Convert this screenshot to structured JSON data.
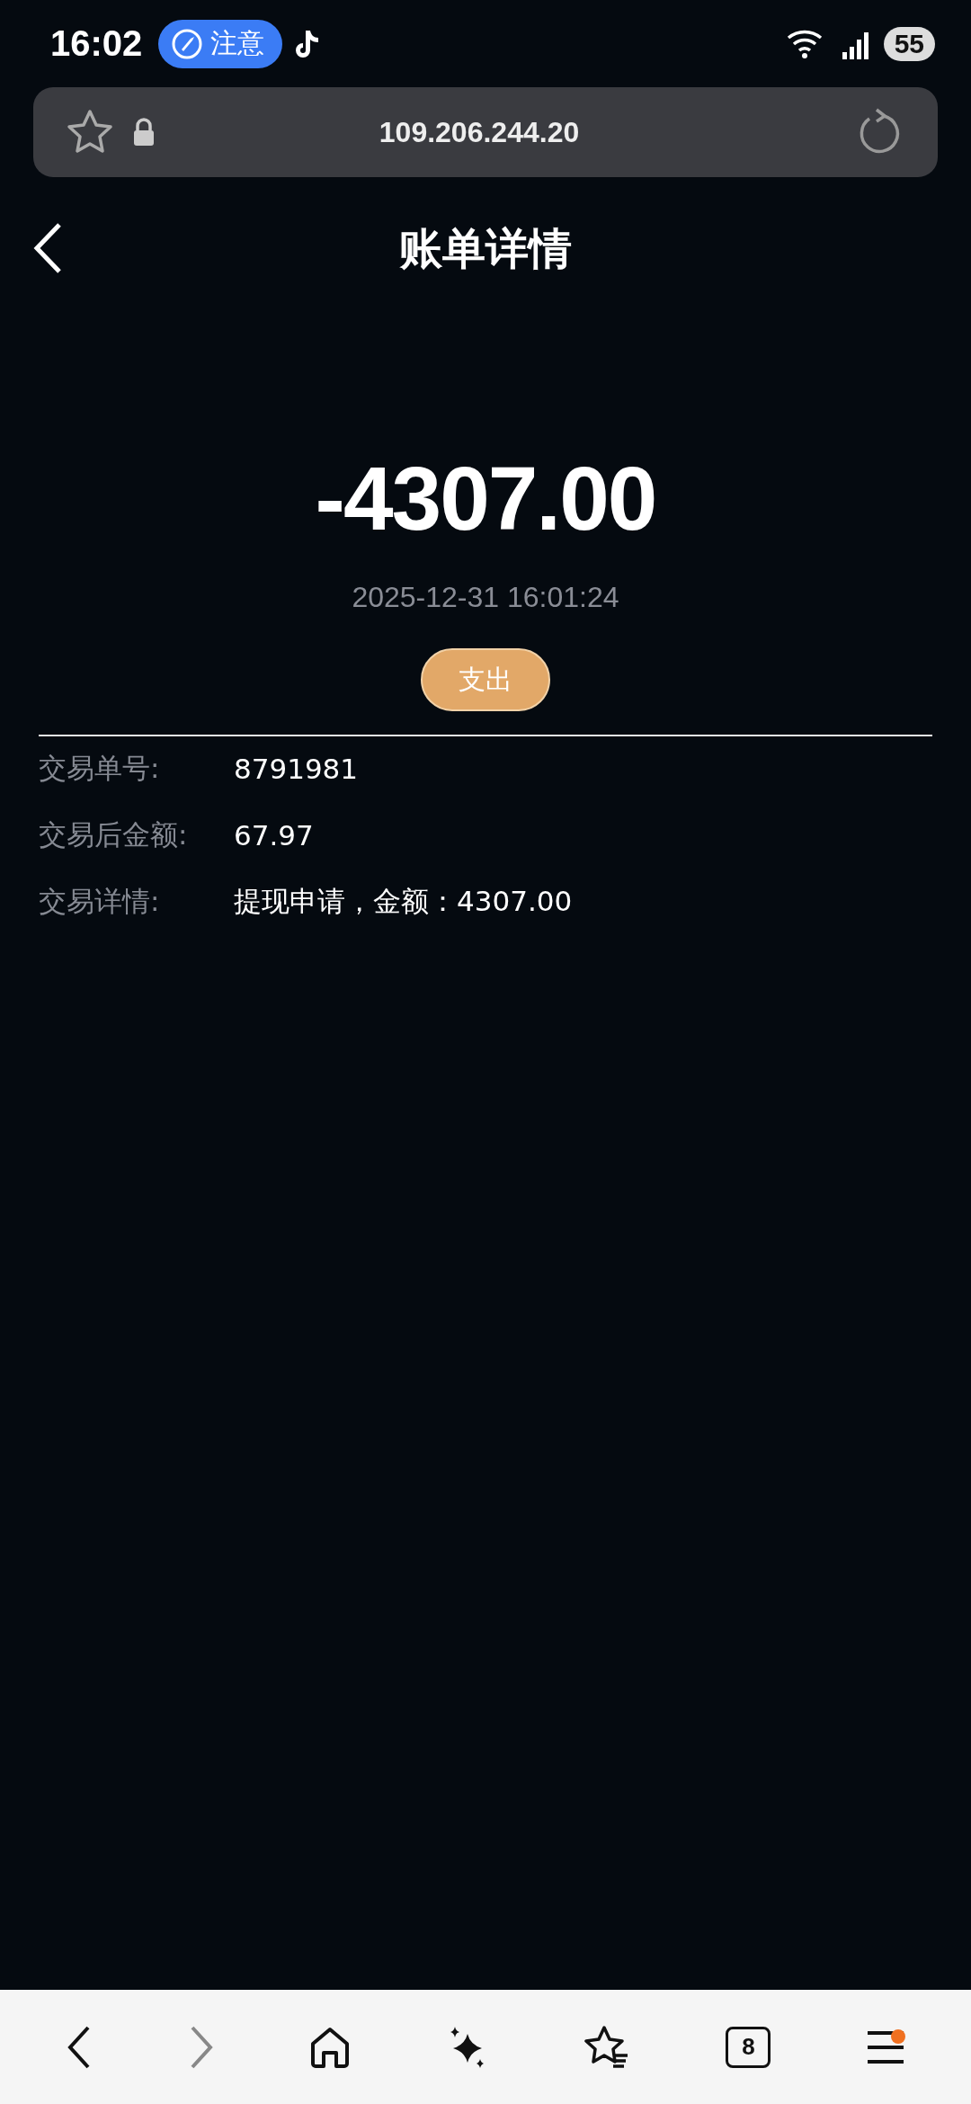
{
  "status_bar": {
    "time": "16:02",
    "alert_chip": "注意",
    "battery": "55"
  },
  "browser": {
    "url": "109.206.244.20"
  },
  "header": {
    "title": "账单详情"
  },
  "bill": {
    "amount": "-4307.00",
    "datetime": "2025-12-31 16:01:24",
    "type_tag": "支出"
  },
  "details": [
    {
      "label": "交易单号:",
      "value": "8791981"
    },
    {
      "label": "交易后金额:",
      "value": "67.97"
    },
    {
      "label": "交易详情:",
      "value": "提现申请，金额：4307.00"
    }
  ],
  "bottom_nav": {
    "tab_count": "8",
    "menu_badge": true
  }
}
